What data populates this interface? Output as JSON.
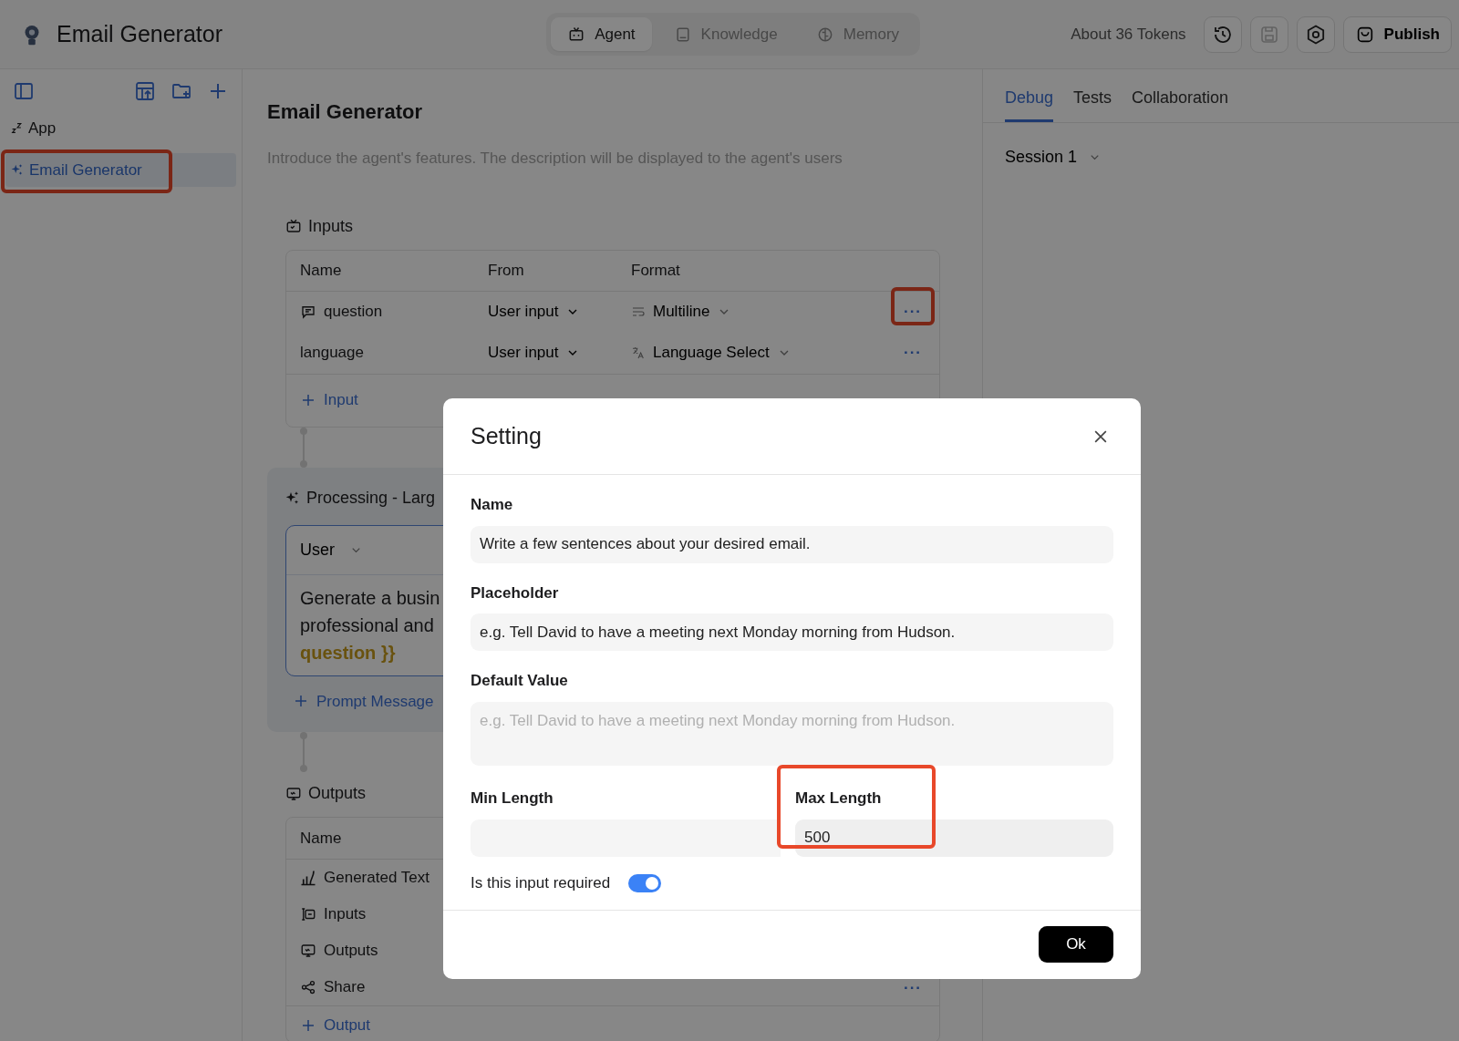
{
  "app": {
    "title": "Email Generator"
  },
  "mode_tabs": [
    {
      "label": "Agent",
      "selected": true
    },
    {
      "label": "Knowledge",
      "selected": false
    },
    {
      "label": "Memory",
      "selected": false
    }
  ],
  "tokens": "About 36 Tokens",
  "publish": "Publish",
  "sidebar": {
    "items": [
      {
        "label": "App",
        "selected": false,
        "children": [
          {
            "label": "Email Generator",
            "selected": true,
            "highlighted": true
          }
        ]
      }
    ]
  },
  "editor": {
    "title": "Email Generator",
    "description_placeholder": "Introduce the agent's features. The description will be displayed to the agent's users",
    "inputs": {
      "heading": "Inputs",
      "columns": [
        "Name",
        "From",
        "Format"
      ],
      "rows": [
        {
          "name": "question",
          "kind": "message",
          "from": "User input",
          "format": {
            "text": "Multiline",
            "kind": "multiline"
          },
          "more": "···",
          "highlighted": true
        },
        {
          "name": "language",
          "kind": "plain",
          "from": "User input",
          "format": {
            "text": "Language Select",
            "kind": "language"
          },
          "more": "···",
          "highlighted": false
        }
      ],
      "add": "Input"
    },
    "processing": {
      "heading": "Processing -  Larg",
      "message": {
        "role": "User",
        "lines": [
          {
            "text": "Generate a busin",
            "kind": "text"
          },
          {
            "text": "professional and",
            "kind": "text"
          },
          {
            "text": "question }}",
            "kind": "variable"
          }
        ]
      },
      "add": "Prompt Message"
    },
    "outputs": {
      "heading": "Outputs",
      "columns": [
        "Name"
      ],
      "rows": [
        {
          "name": "Generated Text",
          "kind": "text"
        },
        {
          "name": "Inputs",
          "kind": "inputs"
        },
        {
          "name": "Outputs",
          "kind": "outputs"
        },
        {
          "name": "Share",
          "kind": "share",
          "more": "···"
        }
      ],
      "add": "Output"
    }
  },
  "debug": {
    "tabs": [
      {
        "label": "Debug",
        "selected": true
      },
      {
        "label": "Tests",
        "selected": false
      },
      {
        "label": "Collaboration",
        "selected": false
      }
    ],
    "session": "Session 1"
  },
  "dialog": {
    "title": "Setting",
    "fields": [
      {
        "label": "Name",
        "kind": "input",
        "value": "Write a few sentences about your desired email."
      },
      {
        "label": "Placeholder",
        "kind": "input",
        "value": "e.g. Tell David to have a meeting next Monday morning from Hudson."
      },
      {
        "label": "Default Value",
        "kind": "textarea",
        "placeholder": "e.g. Tell David to have a meeting next Monday morning from Hudson."
      }
    ],
    "min_length": {
      "label": "Min Length"
    },
    "max_length": {
      "label": "Max Length",
      "value": "500",
      "highlighted": true
    },
    "required": {
      "label": "Is this input required",
      "on": true
    },
    "ok": "Ok"
  }
}
